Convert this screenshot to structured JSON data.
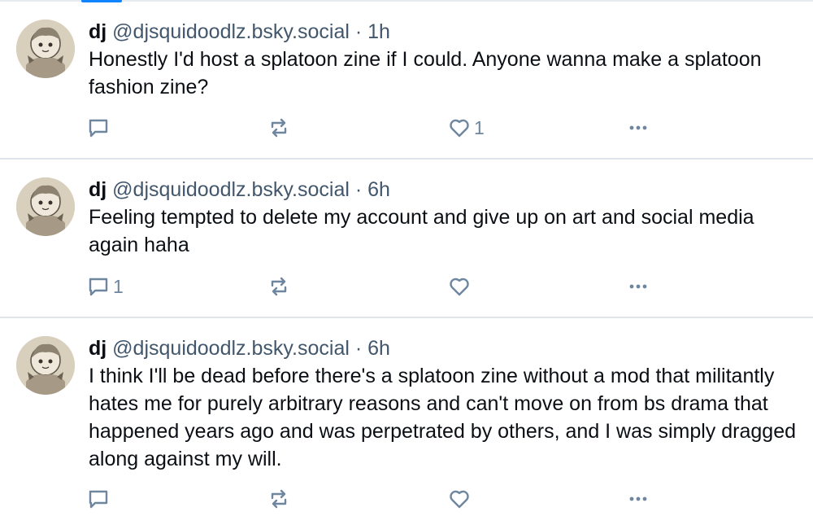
{
  "posts": [
    {
      "author_name": "dj",
      "handle": "@djsquidoodlz.bsky.social",
      "separator": "·",
      "time": "1h",
      "text": "Honestly I'd host a splatoon zine if I could. Anyone wanna make a splatoon fashion zine?",
      "reply_count": "",
      "repost_count": "",
      "like_count": "1"
    },
    {
      "author_name": "dj",
      "handle": "@djsquidoodlz.bsky.social",
      "separator": "·",
      "time": "6h",
      "text": "Feeling tempted to delete my account and give up on art and social media again haha",
      "reply_count": "1",
      "repost_count": "",
      "like_count": ""
    },
    {
      "author_name": "dj",
      "handle": "@djsquidoodlz.bsky.social",
      "separator": "·",
      "time": "6h",
      "text": "I think I'll be dead before there's a splatoon zine without a mod that militantly hates me for purely arbitrary reasons and can't move on from bs drama that happened years ago and was perpetrated by others, and I was simply dragged along against my will.",
      "reply_count": "",
      "repost_count": "",
      "like_count": ""
    }
  ],
  "icons": {
    "reply": "speech-bubble-icon",
    "repost": "repost-arrows-icon",
    "like": "heart-icon",
    "more": "ellipsis-icon"
  },
  "colors": {
    "text": "#0b0f14",
    "muted": "#42576c",
    "icon": "#6f869f",
    "divider": "#dfe5eb",
    "accent": "#1083fe"
  }
}
